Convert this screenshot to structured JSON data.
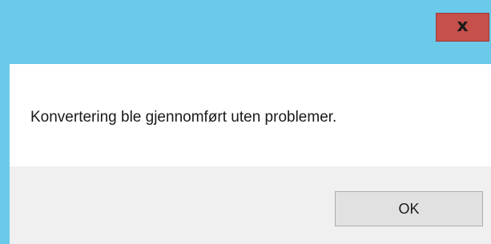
{
  "title_bar": {
    "close_label": "x",
    "close_icon": "close-icon",
    "background_color": "#6bc9ea",
    "close_color": "#c6504a"
  },
  "message": {
    "text": "Konvertering ble gjennomført uten problemer."
  },
  "buttons": {
    "ok_label": "OK"
  }
}
